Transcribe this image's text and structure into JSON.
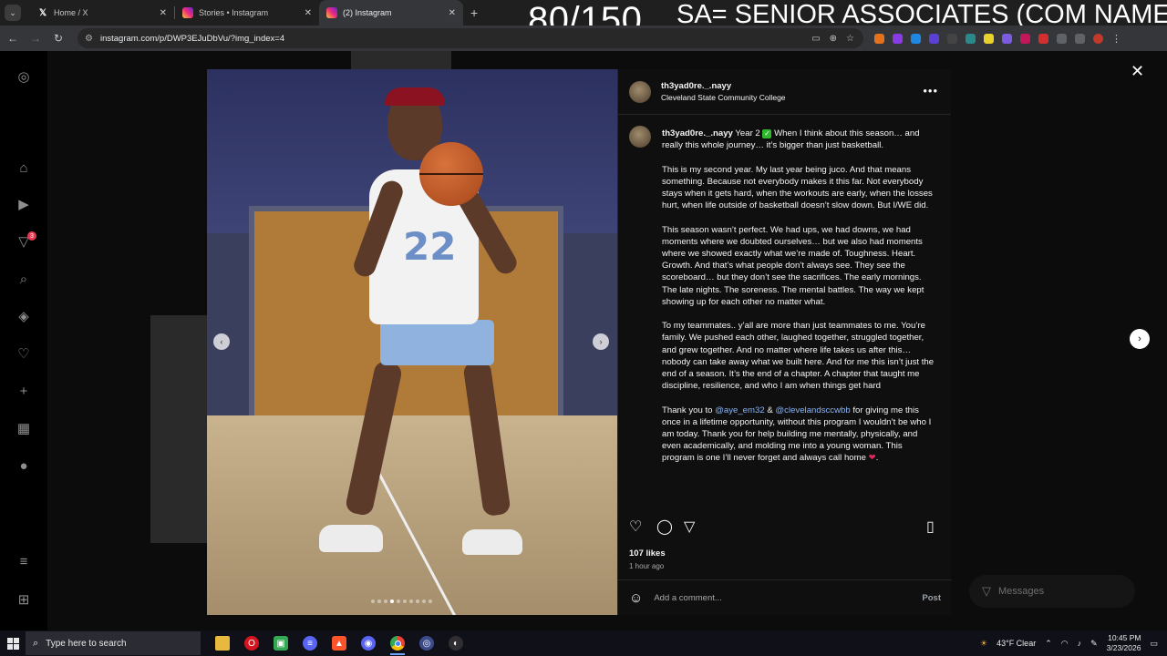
{
  "browser": {
    "tabs": [
      {
        "title": "Home / X",
        "icon": "x-logo-icon",
        "active": false
      },
      {
        "title": "Stories • Instagram",
        "icon": "instagram-icon",
        "active": false
      },
      {
        "title": "(2) Instagram",
        "icon": "instagram-icon",
        "active": true
      }
    ],
    "new_tab": "+",
    "url": "instagram.com/p/DWP3EJuDbVu/?img_index=4"
  },
  "overlay": {
    "counter": "80/150",
    "note": "SA= SENIOR ASSOCIATES (COM NAME)"
  },
  "post": {
    "username": "th3yad0re._.nayy",
    "location": "Cleveland State Community College",
    "caption": {
      "p1_intro": "Year 2",
      "p1_rest": " When I think about this season… and really this whole journey… it’s bigger than just basketball.",
      "p2": "This is my second year. My last year being juco. And that means something. Because not everybody makes it this far. Not everybody stays when it gets hard, when the workouts are early, when the losses hurt, when life outside of basketball doesn’t slow down. But I/WE did.",
      "p3": "This season wasn’t perfect. We had ups, we had downs, we had moments where we doubted ourselves… but we also had moments where we showed exactly what we’re made of. Toughness. Heart. Growth. And that’s what people don’t always see. They see the scoreboard… but they don’t see the sacrifices. The early mornings. The late nights. The soreness. The mental battles. The way we kept showing up for each other no matter what.",
      "p4": "To my teammates.. y’all are more than just teammates to me. You’re family. We pushed each other, laughed together, struggled together, and grew together. And no matter where life takes us after this… nobody can take away what we built here. And for me this isn’t just the end of a season. It’s the end of a chapter. A chapter that taught me discipline, resilience, and who I am when things get hard",
      "p5_a": "Thank you to ",
      "mention1": "@aye_em32",
      "p5_b": " & ",
      "mention2": "@clevelandsccwbb",
      "p5_c": " for giving me this once in a lifetime opportunity, without this program I wouldn’t be who I am today. Thank you for help building me mentally, physically, and even academically, and molding me into a young woman. This program is one I’ll never forget and always call home ",
      "p5_end": "."
    },
    "likes": "107 likes",
    "time_ago": "1 hour ago",
    "comment_placeholder": "Add a comment...",
    "post_button": "Post",
    "image": {
      "jersey_number": "22",
      "slide_count": 10,
      "active_slide": 4
    }
  },
  "sidebar": {
    "badge": "3",
    "messages_label": "Messages"
  },
  "taskbar": {
    "search_placeholder": "Type here to search",
    "weather": "43°F  Clear",
    "time": "10:45 PM",
    "date": "3/23/2026"
  }
}
